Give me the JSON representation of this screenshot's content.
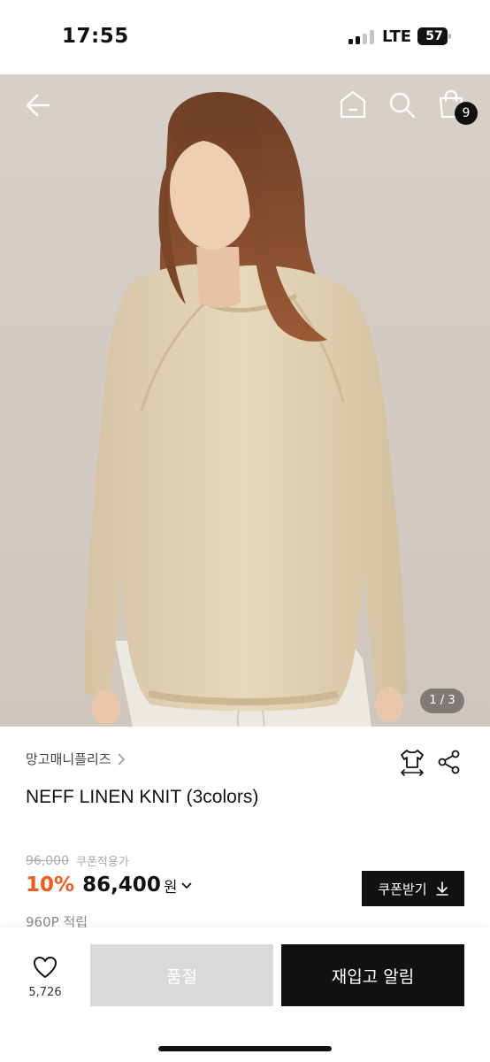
{
  "status_bar": {
    "time": "17:55",
    "network": "LTE",
    "battery_level": "57",
    "signal_bars_active": 2,
    "signal_bars_total": 4
  },
  "header": {
    "back_icon": "arrow-left-icon",
    "home_icon": "home-icon",
    "search_icon": "search-icon",
    "cart_icon": "shopping-bag-icon",
    "cart_count": "9"
  },
  "gallery": {
    "counter": "1 / 3"
  },
  "product": {
    "brand": "망고매니플리즈",
    "title": "NEFF LINEN KNIT (3colors)",
    "original_price": "96,000",
    "coupon_note": "쿠폰적용가",
    "discount": "10%",
    "price": "86,400",
    "currency": "원",
    "coupon_button": "쿠폰받기",
    "points": "960P 적립"
  },
  "bottom_bar": {
    "like_count": "5,726",
    "soldout_label": "품절",
    "restock_label": "재입고 알림"
  },
  "colors": {
    "accent_discount": "#f05a1a",
    "primary_button": "#111111",
    "disabled_button": "#d9d9d9"
  }
}
